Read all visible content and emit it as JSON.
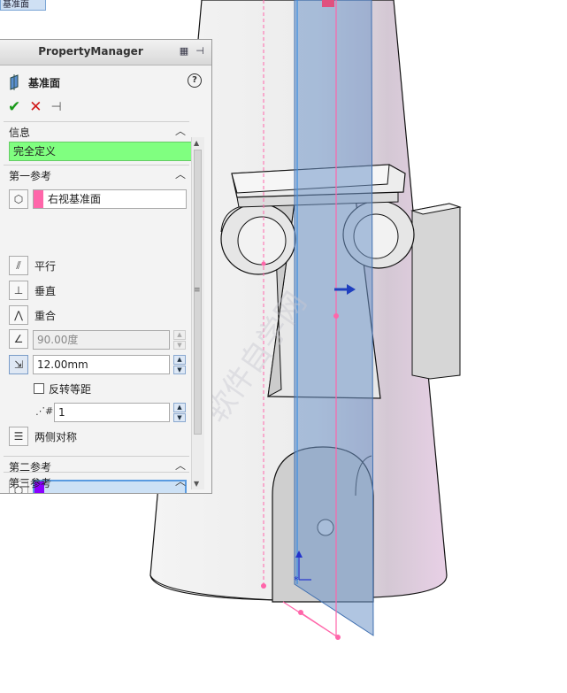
{
  "top_tab_label": "基准面",
  "property_manager": {
    "title": "PropertyManager",
    "feature_name": "基准面",
    "help": "?",
    "sections": {
      "info": {
        "title": "信息",
        "status": "完全定义"
      },
      "first_ref": {
        "title": "第一参考",
        "reference_value": "右视基准面",
        "options": {
          "parallel": "平行",
          "perpendicular": "垂直",
          "coincident": "重合",
          "angle_value": "90.00度",
          "distance_value": "12.00mm",
          "flip_offset": "反转等距",
          "count_value": "1",
          "mid_plane": "两侧对称"
        }
      },
      "second_ref": {
        "title": "第二参考",
        "reference_value": ""
      },
      "third_ref": {
        "title": "第三参考"
      }
    }
  },
  "watermark": "软件自学网",
  "colors": {
    "status_green": "#80ff80",
    "ref1_swatch": "#ff66aa",
    "ref2_swatch": "#8a00ff",
    "plane_blue": "#6f96c8",
    "model_pink": "#d9c6d9"
  }
}
